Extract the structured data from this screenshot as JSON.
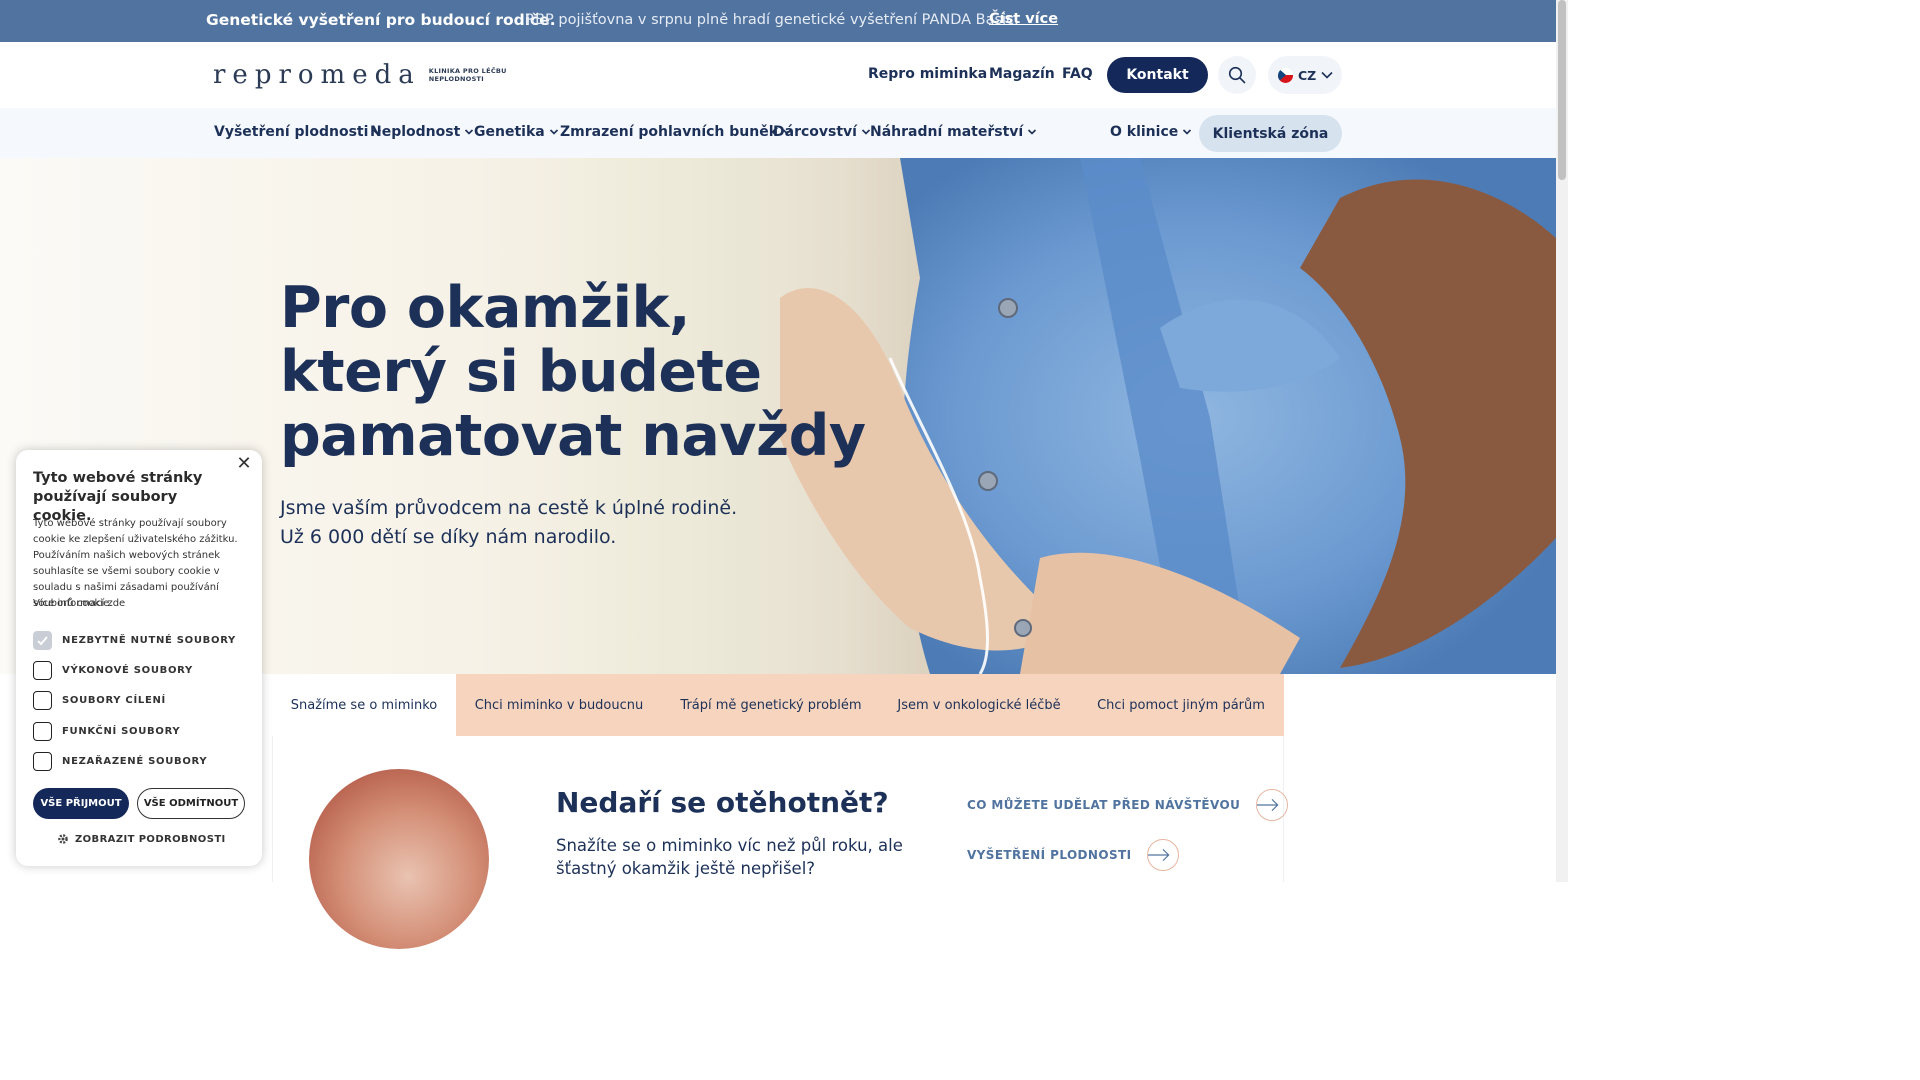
{
  "banner": {
    "bold_text": "Genetické vyšetření pro budoucí rodiče.",
    "text": "RBP pojišťovna v srpnu plně hradí genetické vyšetření PANDA Basic.",
    "link": "Číst více"
  },
  "header": {
    "logo_text": "repromeda",
    "logo_tag_line1": "KLINIKA PRO LÉČBU",
    "logo_tag_line2": "NEPLODNOSTI",
    "links": [
      "Repro miminka",
      "Magazín",
      "FAQ"
    ],
    "contact_button": "Kontakt",
    "language": "CZ"
  },
  "mainnav": {
    "items": [
      "Vyšetření plodnosti",
      "Neplodnost",
      "Genetika",
      "Zmrazení pohlavních buněk",
      "Dárcovství",
      "Náhradní mateřství"
    ],
    "about": "O klinice",
    "client_zone": "Klientská zóna"
  },
  "hero": {
    "title_line1": "Pro okamžik,",
    "title_line2": "který si budete",
    "title_line3": "pamatovat navždy",
    "subtitle_line1": "Jsme vaším průvodcem na cestě k úplné rodině.",
    "subtitle_line2": "Už 6 000 dětí se díky nám narodilo."
  },
  "tabs": [
    "Snažíme se o miminko",
    "Chci miminko v budoucnu",
    "Trápí mě genetický problém",
    "Jsem v onkologické léčbě",
    "Chci pomoct jiným párům"
  ],
  "content": {
    "heading": "Nedaří se otěhotnět?",
    "text": "Snažíte se o miminko víc než půl roku, ale šťastný okamžik ještě nepřišel?",
    "links": [
      "CO MŮŽETE UDĚLAT PŘED NÁVŠTĚVOU",
      "VYŠETŘENÍ PLODNOSTI"
    ]
  },
  "cookie": {
    "title": "Tyto webové stránky používají soubory cookie.",
    "text": "Tyto webové stránky používají soubory cookie ke zlepšení uživatelského zážitku. Používáním našich webových stránek souhlasíte se všemi soubory cookie v souladu s našimi zásadami používání souborů cookie.",
    "more": "Více informací zde",
    "options": [
      {
        "label": "NEZBYTNĚ NUTNÉ SOUBORY",
        "checked": true
      },
      {
        "label": "VÝKONOVÉ SOUBORY",
        "checked": false
      },
      {
        "label": "SOUBORY CÍLENÍ",
        "checked": false
      },
      {
        "label": "FUNKČNÍ SOUBORY",
        "checked": false
      },
      {
        "label": "NEZAŘAZENÉ SOUBORY",
        "checked": false
      }
    ],
    "accept": "VŠE PŘIJMOUT",
    "decline": "VŠE ODMÍTNOUT",
    "details": "ZOBRAZIT PODROBNOSTI"
  },
  "colors": {
    "banner": "#51739f",
    "navy": "#14295a",
    "text": "#1d3158",
    "tab_bg": "#f7d4bd",
    "client_zone": "#d7e2ef"
  }
}
